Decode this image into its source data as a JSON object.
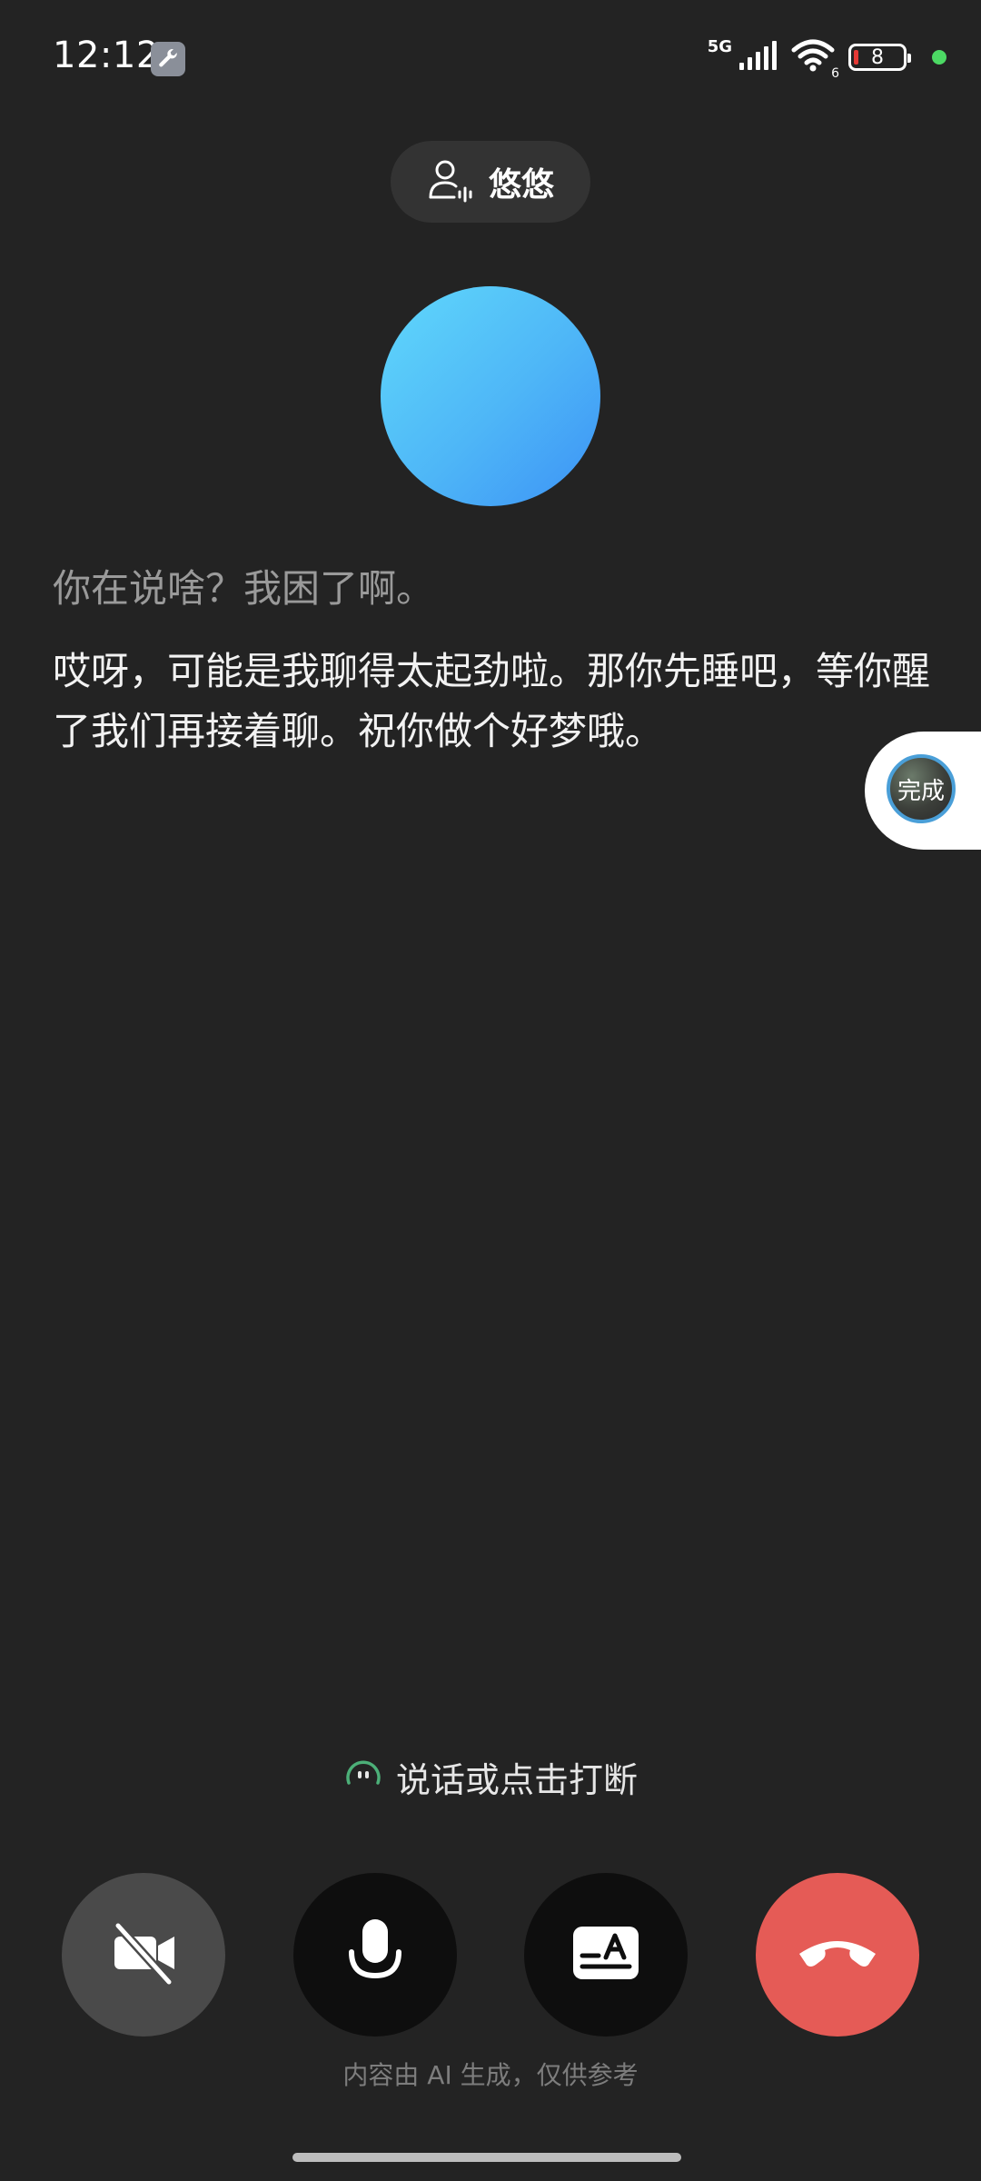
{
  "status_bar": {
    "time": "12:12",
    "network": "5G",
    "wifi_badge": "6",
    "battery": "8"
  },
  "voice_chip": {
    "name": "悠悠"
  },
  "transcript": {
    "user": "你在说啥？我困了啊。",
    "assistant": "哎呀，可能是我聊得太起劲啦。那你先睡吧，等你醒了我们再接着聊。祝你做个好梦哦。"
  },
  "floating_bubble": {
    "label": "完成"
  },
  "hint": {
    "text": "说话或点击打断"
  },
  "footer": {
    "note": "内容由 AI 生成，仅供参考"
  },
  "colors": {
    "background": "#232323",
    "hangup": "#e55b56",
    "orb_start": "#60d8fb",
    "orb_end": "#3c92f6"
  }
}
